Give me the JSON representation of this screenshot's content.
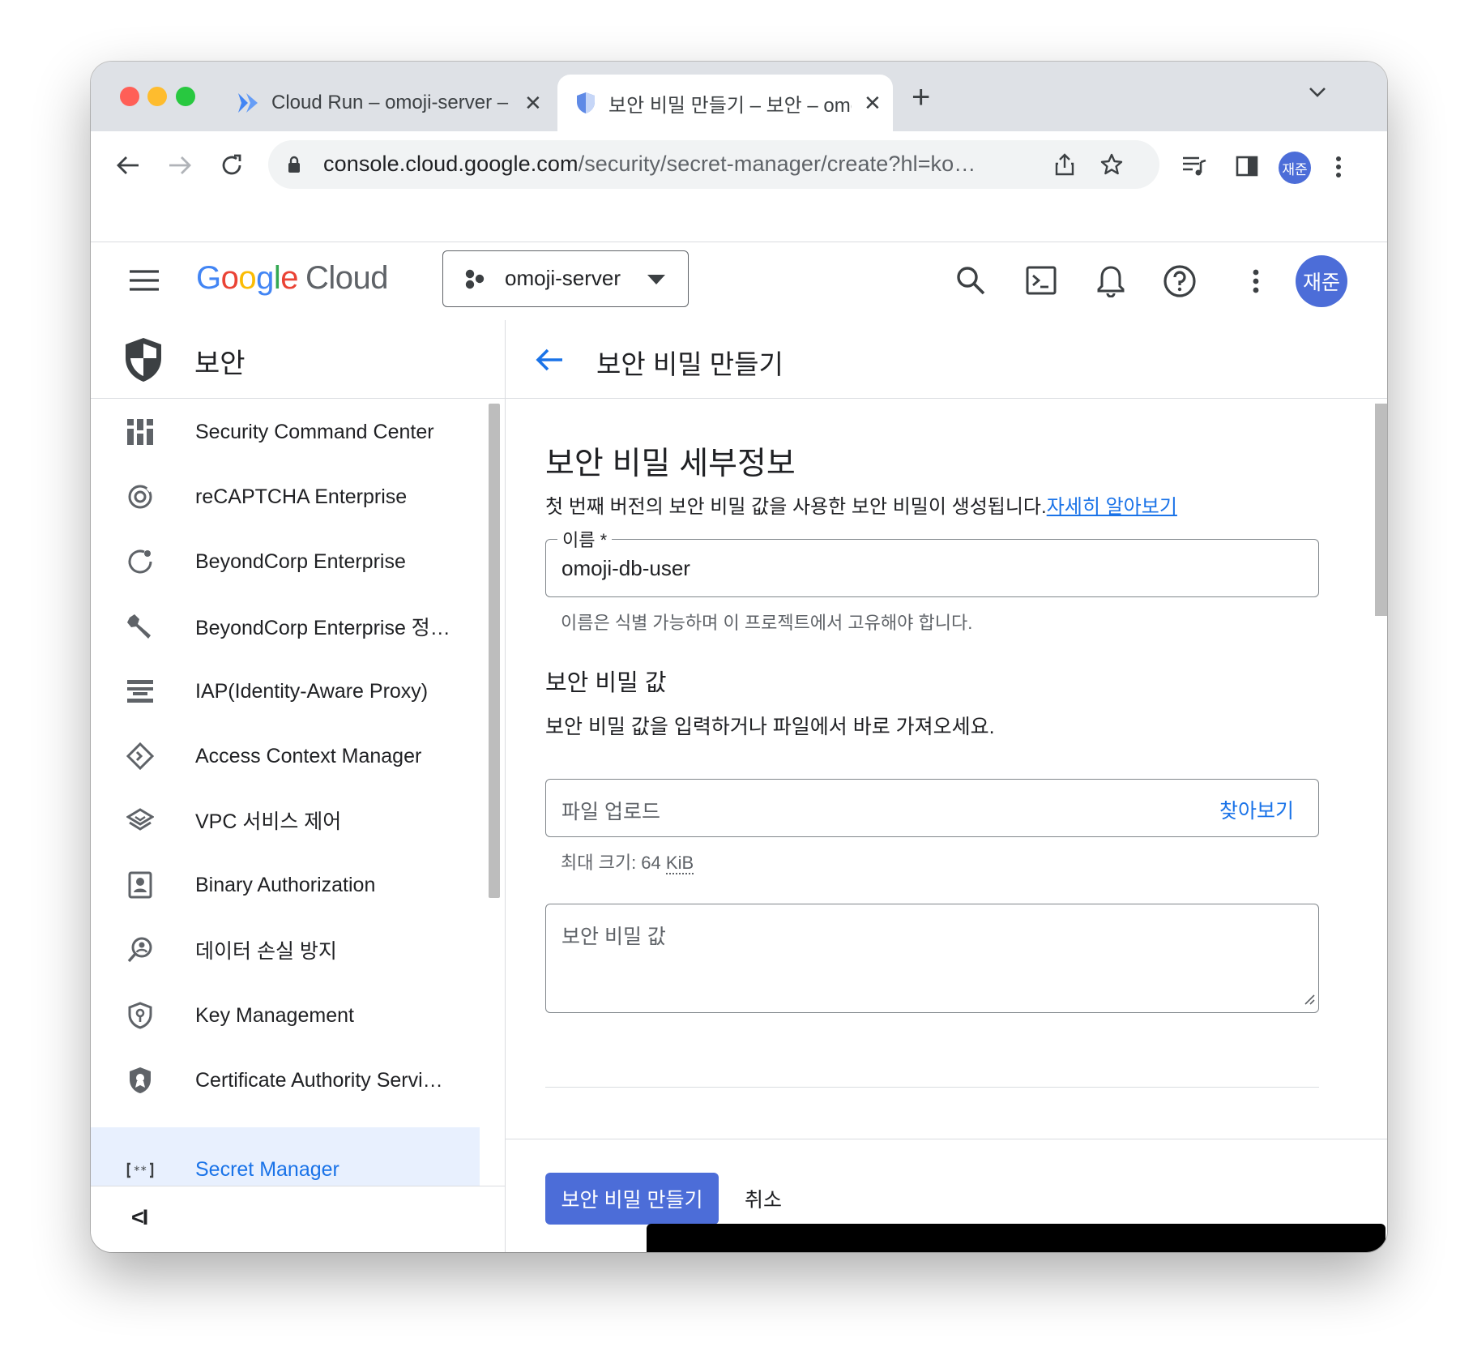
{
  "browser": {
    "tabs": [
      {
        "title": "Cloud Run – omoji-server – Go",
        "close": "✕"
      },
      {
        "title": "보안 비밀 만들기 – 보안 – omoji-se",
        "close": "✕"
      }
    ],
    "new_tab": "+",
    "tab_search": "⌄",
    "url_host": "console.cloud.google.com",
    "url_path": "/security/secret-manager/create?hl=ko…",
    "profile_initials": "재준"
  },
  "header": {
    "logo_google": [
      "G",
      "o",
      "o",
      "g",
      "l",
      "e"
    ],
    "logo_cloud": "Cloud",
    "logo_colors": [
      "#4285f4",
      "#ea4335",
      "#fbbc04",
      "#4285f4",
      "#34a853",
      "#ea4335"
    ],
    "project": "omoji-server",
    "avatar_initials": "재준"
  },
  "sidebar": {
    "title": "보안",
    "items": [
      {
        "label": "Security Command Center",
        "icon": "dashboard-icon"
      },
      {
        "label": "reCAPTCHA Enterprise",
        "icon": "recaptcha-icon"
      },
      {
        "label": "BeyondCorp Enterprise",
        "icon": "beyondcorp-icon"
      },
      {
        "label": "BeyondCorp Enterprise 정…",
        "icon": "wrench-icon"
      },
      {
        "label": "IAP(Identity-Aware Proxy)",
        "icon": "iap-icon"
      },
      {
        "label": "Access Context Manager",
        "icon": "diamond-icon"
      },
      {
        "label": "VPC 서비스 제어",
        "icon": "layers-icon"
      },
      {
        "label": "Binary Authorization",
        "icon": "id-badge-icon"
      },
      {
        "label": "데이터 손실 방지",
        "icon": "dlp-icon"
      },
      {
        "label": "Key Management",
        "icon": "key-shield-icon"
      },
      {
        "label": "Certificate Authority Servi…",
        "icon": "certificate-icon"
      },
      {
        "label": "Secret Manager",
        "icon": "secret-icon"
      }
    ],
    "active_index": 11,
    "collapse": "<I"
  },
  "main": {
    "back_title": "보안 비밀 만들기",
    "section_title": "보안 비밀 세부정보",
    "description": "첫 번째 버전의 보안 비밀 값을 사용한 보안 비밀이 생성됩니다.",
    "learn_more": "자세히 알아보기",
    "name_label": "이름 *",
    "name_value": "omoji-db-user",
    "name_hint": "이름은 식별 가능하며 이 프로젝트에서 고유해야 합니다.",
    "value_title": "보안 비밀 값",
    "value_desc": "보안 비밀 값을 입력하거나 파일에서 바로 가져오세요.",
    "upload_placeholder": "파일 업로드",
    "browse": "찾아보기",
    "max_size": "최대 크기: 64",
    "max_size_unit": "KiB",
    "secret_placeholder": "보안 비밀 값",
    "create_button": "보안 비밀 만들기",
    "cancel_button": "취소"
  },
  "colors": {
    "accent": "#1a73e8",
    "primary_button": "#4c6dd8",
    "active_nav_bg": "#e8f0fe"
  }
}
